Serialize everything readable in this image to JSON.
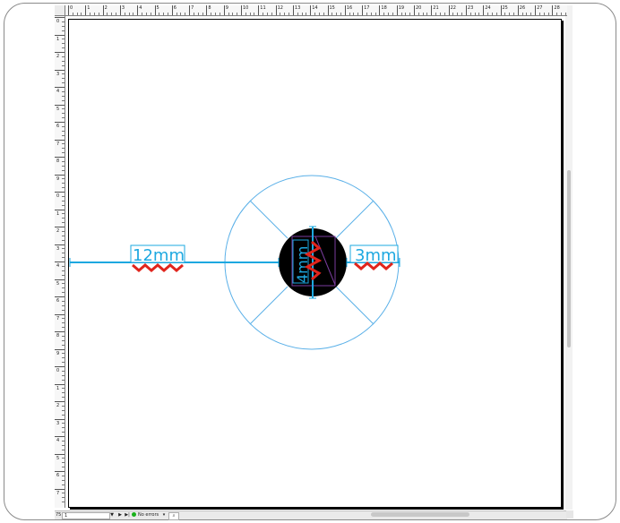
{
  "ruler": {
    "top_labels": [
      "0",
      "1",
      "2",
      "3",
      "4",
      "5",
      "6",
      "7",
      "8",
      "9",
      "10",
      "11",
      "12",
      "13",
      "14",
      "15",
      "16",
      "17",
      "18",
      "19",
      "20",
      "21",
      "22",
      "23",
      "24",
      "25",
      "26",
      "27",
      "28"
    ],
    "left_labels": [
      "0",
      "1",
      "2",
      "3",
      "4",
      "5",
      "6",
      "7",
      "8",
      "9",
      "0",
      "1",
      "2",
      "3",
      "4",
      "5",
      "6",
      "7",
      "8",
      "9",
      "0",
      "1",
      "2",
      "3",
      "4",
      "5",
      "6",
      "7"
    ]
  },
  "drawing": {
    "dim_left": "12mm",
    "dim_vertical": "4mm",
    "dim_right": "3mm",
    "colors": {
      "guide": "#1da8e0",
      "circle_outline": "#5ab0e8",
      "fill": "#000000",
      "squiggle": "#e0241c",
      "box": "#7a3d9e"
    }
  },
  "statusbar": {
    "zoom_value": "75",
    "page_value": "1",
    "errors_label": "No errors",
    "first_btn": "|◀",
    "prev_btn": "▼",
    "next_btn": "▶",
    "last_btn": "▶|",
    "dropdown": "▾"
  }
}
